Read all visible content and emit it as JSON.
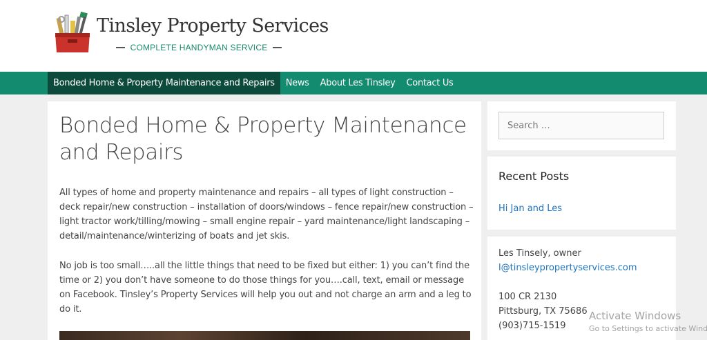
{
  "header": {
    "site_title": "Tinsley Property Services",
    "tagline": "COMPLETE HANDYMAN SERVICE",
    "logo_icon": "toolbox-icon"
  },
  "nav": {
    "items": [
      {
        "label": "Bonded Home & Property Maintenance and Repairs",
        "active": true
      },
      {
        "label": "News",
        "active": false
      },
      {
        "label": "About Les Tinsley",
        "active": false
      },
      {
        "label": "Contact Us",
        "active": false
      }
    ]
  },
  "main": {
    "title": "Bonded Home & Property Maintenance and Repairs",
    "paragraphs": [
      "All types of home and property maintenance and repairs – all types of light construction – deck repair/new construction – installation of doors/windows – fence repair/new construction – light tractor work/tilling/mowing – small engine repair – yard maintenance/light landscaping – detail/maintenance/winterizing of boats and jet skis.",
      "No job is too small…..all the little things that need to be fixed but either: 1) you can’t find the time or 2) you don’t have someone to do those things for you….call, text, email or message on Facebook. Tinsley’s Property Services will help you out and not charge an arm and a leg to do it."
    ]
  },
  "sidebar": {
    "search": {
      "placeholder": "Search …"
    },
    "recent_posts": {
      "title": "Recent Posts",
      "items": [
        "Hi Jan and Les"
      ]
    },
    "contact": {
      "owner": "Les Tinsely, owner",
      "email": "l@tinsleypropertyservices.com",
      "address1": "100 CR 2130",
      "address2": "Pittsburg, TX 75686",
      "phone": "(903)715-1519"
    }
  },
  "watermark": {
    "title": "Activate Windows",
    "subtitle": "Go to Settings to activate Windows."
  },
  "colors": {
    "nav_bg": "#128b6f",
    "nav_active": "#0c4a3c",
    "link": "#1e73be",
    "tagline": "#1a8a6a"
  }
}
